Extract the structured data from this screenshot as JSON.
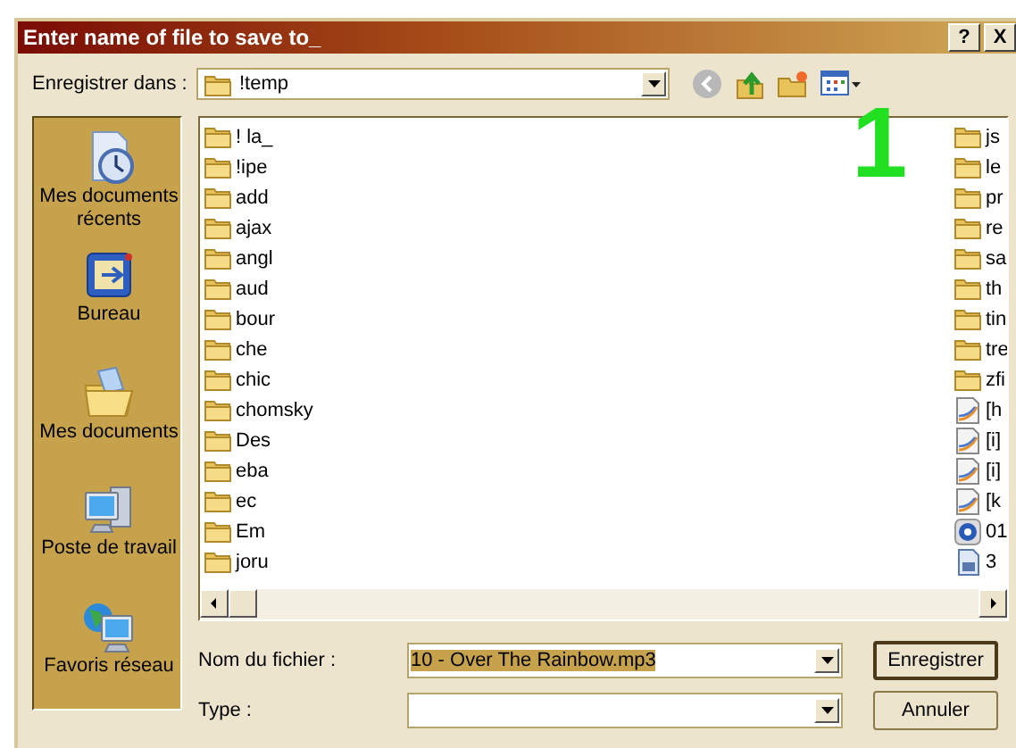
{
  "window": {
    "title": "Enter name of file to save to_",
    "buttons": [
      {
        "kind": "help",
        "label": "?"
      },
      {
        "kind": "close",
        "label": "X"
      }
    ]
  },
  "save_in": {
    "label": "Enregistrer dans :",
    "value": "!temp"
  },
  "toolbar": [
    {
      "kind": "back",
      "disabled": true
    },
    {
      "kind": "up",
      "disabled": false
    },
    {
      "kind": "new_folder",
      "disabled": false
    },
    {
      "kind": "views",
      "disabled": false
    }
  ],
  "places": [
    {
      "kind": "recent",
      "label": "Mes documents récents"
    },
    {
      "kind": "desktop",
      "label": "Bureau"
    },
    {
      "kind": "documents",
      "label": "Mes documents"
    },
    {
      "kind": "computer",
      "label": "Poste de travail"
    },
    {
      "kind": "network",
      "label": "Favoris réseau"
    }
  ],
  "files": {
    "columns": [
      [
        {
          "kind": "folder",
          "name": "! la_"
        },
        {
          "kind": "folder",
          "name": "!ipe"
        },
        {
          "kind": "folder",
          "name": "add"
        },
        {
          "kind": "folder",
          "name": "ajax"
        },
        {
          "kind": "folder",
          "name": "angl"
        },
        {
          "kind": "folder",
          "name": "aud"
        },
        {
          "kind": "folder",
          "name": "bour"
        },
        {
          "kind": "folder",
          "name": "che"
        },
        {
          "kind": "folder",
          "name": "chic"
        },
        {
          "kind": "folder",
          "name": "chomsky"
        },
        {
          "kind": "folder",
          "name": "Des"
        },
        {
          "kind": "folder",
          "name": "eba"
        },
        {
          "kind": "folder",
          "name": "ec"
        },
        {
          "kind": "folder",
          "name": "Em"
        },
        {
          "kind": "folder",
          "name": "joru"
        }
      ],
      [
        {
          "kind": "folder",
          "name": "js"
        },
        {
          "kind": "folder",
          "name": "le"
        },
        {
          "kind": "folder",
          "name": "pr"
        },
        {
          "kind": "folder",
          "name": "re"
        },
        {
          "kind": "folder",
          "name": "sa"
        },
        {
          "kind": "folder",
          "name": "th"
        },
        {
          "kind": "folder",
          "name": "tin"
        },
        {
          "kind": "folder",
          "name": "tre"
        },
        {
          "kind": "folder",
          "name": "zfi"
        },
        {
          "kind": "document",
          "name": "[h"
        },
        {
          "kind": "document",
          "name": "[i]"
        },
        {
          "kind": "document",
          "name": "[i]"
        },
        {
          "kind": "document",
          "name": "[k"
        },
        {
          "kind": "media",
          "name": "01"
        },
        {
          "kind": "image",
          "name": "3"
        }
      ]
    ]
  },
  "filename": {
    "label": "Nom du fichier :",
    "value": "10 - Over The Rainbow.mp3",
    "selected": true
  },
  "type": {
    "label": "Type :"
  },
  "buttons": [
    {
      "label": "Enregistrer",
      "default": true
    },
    {
      "label": "Annuler",
      "default": false
    }
  ],
  "annotation": {
    "text": "1"
  }
}
